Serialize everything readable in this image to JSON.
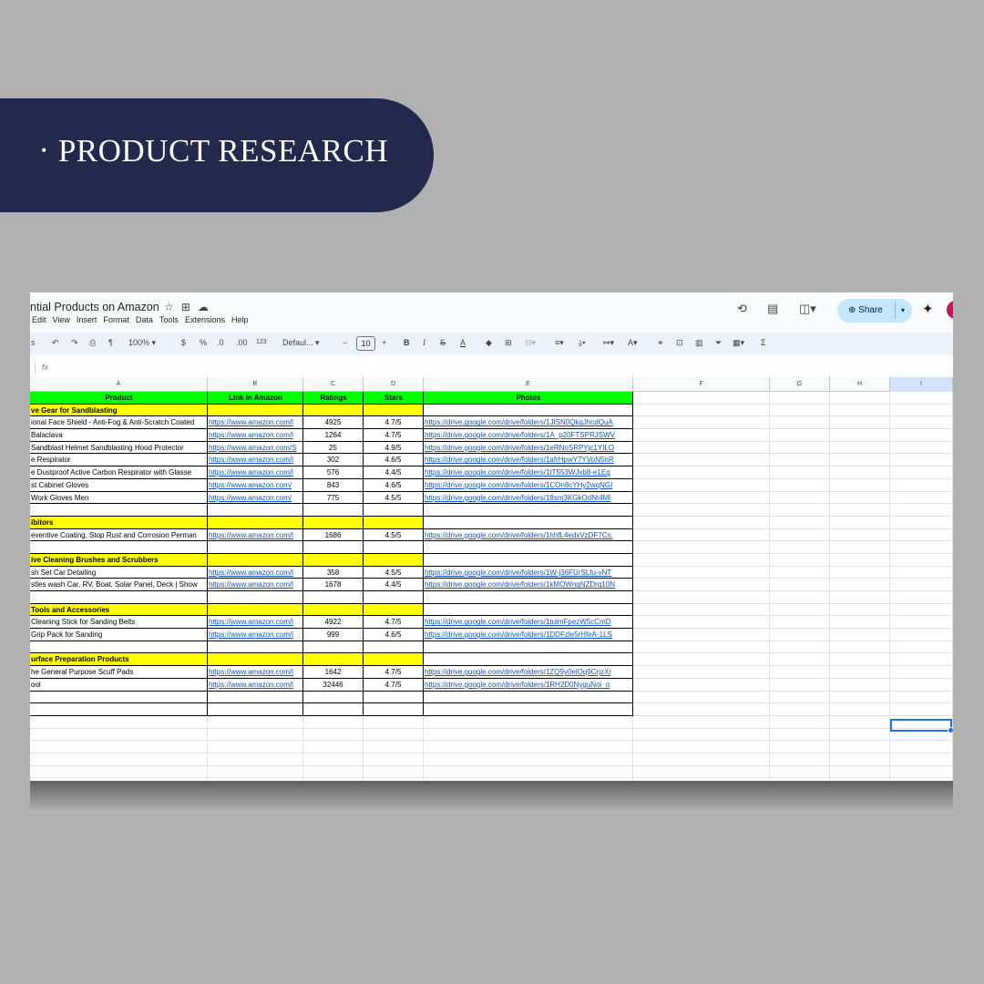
{
  "banner": {
    "bullet": "•",
    "title": "PRODUCT RESEARCH"
  },
  "doc": {
    "title": "ntial Products on Amazon",
    "menu": [
      "Edit",
      "View",
      "Insert",
      "Format",
      "Data",
      "Tools",
      "Extensions",
      "Help"
    ],
    "share_label": "Share"
  },
  "toolbar": {
    "zoom": "100%",
    "currency": "$",
    "percent": "%",
    "dec_decrease": ".0",
    "dec_increase": ".00",
    "number_format": "123",
    "font": "Defaul...",
    "font_size": "10",
    "minus": "−",
    "plus": "+",
    "sigma": "Σ"
  },
  "formula": {
    "fx": "fx"
  },
  "columns": [
    "A",
    "B",
    "C",
    "D",
    "E",
    "F",
    "G",
    "H",
    "I"
  ],
  "table": {
    "headers": [
      "Product",
      "Link in Amazon",
      "Ratings",
      "Stars",
      "Photos"
    ],
    "rows": [
      {
        "type": "section",
        "a": "ve Gear for Sandblasting"
      },
      {
        "type": "data",
        "a": "ional Face Shield - Anti-Fog & Anti-Scratch Coated",
        "b": "https://www.amazon.com/l",
        "c": "4925",
        "d": "4.7/5",
        "e": "https://drive.google.com/drive/folders/1JISN0QkqJhcdQuA"
      },
      {
        "type": "data",
        "a": "Balaclava",
        "b": "https://www.amazon.com/l",
        "c": "1264",
        "d": "4.7/5",
        "e": "https://drive.google.com/drive/folders/1A_p20FTSPRJSWV"
      },
      {
        "type": "data",
        "a": "Sandblast Helmet Sandblasting Hood Protector",
        "b": "https://www.amazon.com/S",
        "c": "25",
        "d": "4.9/5",
        "e": "https://drive.google.com/drive/folders/1eRNoSRPYjc1YILO"
      },
      {
        "type": "data",
        "a": "e Respirator",
        "b": "https://www.amazon.com/l",
        "c": "302",
        "d": "4.6/5",
        "e": "https://drive.google.com/drive/folders/1afrHpwY7YVoN5nR"
      },
      {
        "type": "data",
        "a": "e Dustproof Active Carbon Respirator with Glasse",
        "b": "https://www.amazon.com/l",
        "c": "576",
        "d": "4.4/5",
        "e": "https://drive.google.com/drive/folders/1tT553WJxb8-e1Eg"
      },
      {
        "type": "data",
        "a": "st Cabinet Gloves",
        "b": "https://www.amazon.com/",
        "c": "843",
        "d": "4.6/5",
        "e": "https://drive.google.com/drive/folders/1COn8cYHy2wqNGI"
      },
      {
        "type": "data",
        "a": "Work Gloves Men",
        "b": "https://www.amazon.com/",
        "c": "775",
        "d": "4.5/5",
        "e": "https://drive.google.com/drive/folders/18sm3KGkOdNt4Ml"
      },
      {
        "type": "blank"
      },
      {
        "type": "section",
        "a": "ibitors"
      },
      {
        "type": "data",
        "a": "eventive Coating, Stop Rust and Corrosion Perman",
        "b": "https://www.amazon.com/l",
        "c": "1686",
        "d": "4.5/5",
        "e": "https://drive.google.com/drive/folders/1hhfL4edxVzDF7Cs."
      },
      {
        "type": "blank"
      },
      {
        "type": "section",
        "a": "ive Cleaning Brushes and Scrubbers"
      },
      {
        "type": "data",
        "a": "sh Set Car Detailing",
        "b": "https://www.amazon.com/l",
        "c": "358",
        "d": "4.5/5",
        "e": "https://drive.google.com/drive/folders/1W-j36FUrSLfu-vNT"
      },
      {
        "type": "data",
        "a": "stles wash Car, RV, Boat, Solar Panel, Deck | Show",
        "b": "https://www.amazon.com/l",
        "c": "1678",
        "d": "4.4/5",
        "e": "https://drive.google.com/drive/folders/1kMOWnqNZDrq10N"
      },
      {
        "type": "blank"
      },
      {
        "type": "section",
        "a": "Tools and Accessories"
      },
      {
        "type": "data",
        "a": "Cleaning Stick for Sanding Belts",
        "b": "https://www.amazon.com/l",
        "c": "4922",
        "d": "4.7/5",
        "e": "https://drive.google.com/drive/folders/1tulmFpezW5cCmD"
      },
      {
        "type": "data",
        "a": "Grip Pack for Sanding",
        "b": "https://www.amazon.com/l",
        "c": "999",
        "d": "4.6/5",
        "e": "https://drive.google.com/drive/folders/1DDFzle5rHfeA-1LS"
      },
      {
        "type": "blank"
      },
      {
        "type": "section",
        "a": "urface Preparation Products"
      },
      {
        "type": "data",
        "a": "he General Purpose Scuff Pads",
        "b": "https://www.amazon.com/l",
        "c": "1642",
        "d": "4.7/5",
        "e": "https://drive.google.com/drive/folders/1ZQ9y0elOq9CrjzXi"
      },
      {
        "type": "data",
        "a": "ool",
        "b": "https://www.amazon.com/l",
        "c": "32446",
        "d": "4.7/5",
        "e": "https://drive.google.com/drive/folders/1RH2D0NyguNoi_o"
      },
      {
        "type": "blank"
      },
      {
        "type": "blank"
      },
      {
        "type": "empty"
      },
      {
        "type": "empty"
      },
      {
        "type": "empty"
      },
      {
        "type": "empty"
      },
      {
        "type": "empty"
      },
      {
        "type": "empty"
      }
    ]
  },
  "colors": {
    "header_green": "#00ff00",
    "section_yellow": "#ffff00",
    "link_blue": "#1155cc",
    "banner_navy": "#23284d",
    "share_bg": "#c2e7ff"
  }
}
